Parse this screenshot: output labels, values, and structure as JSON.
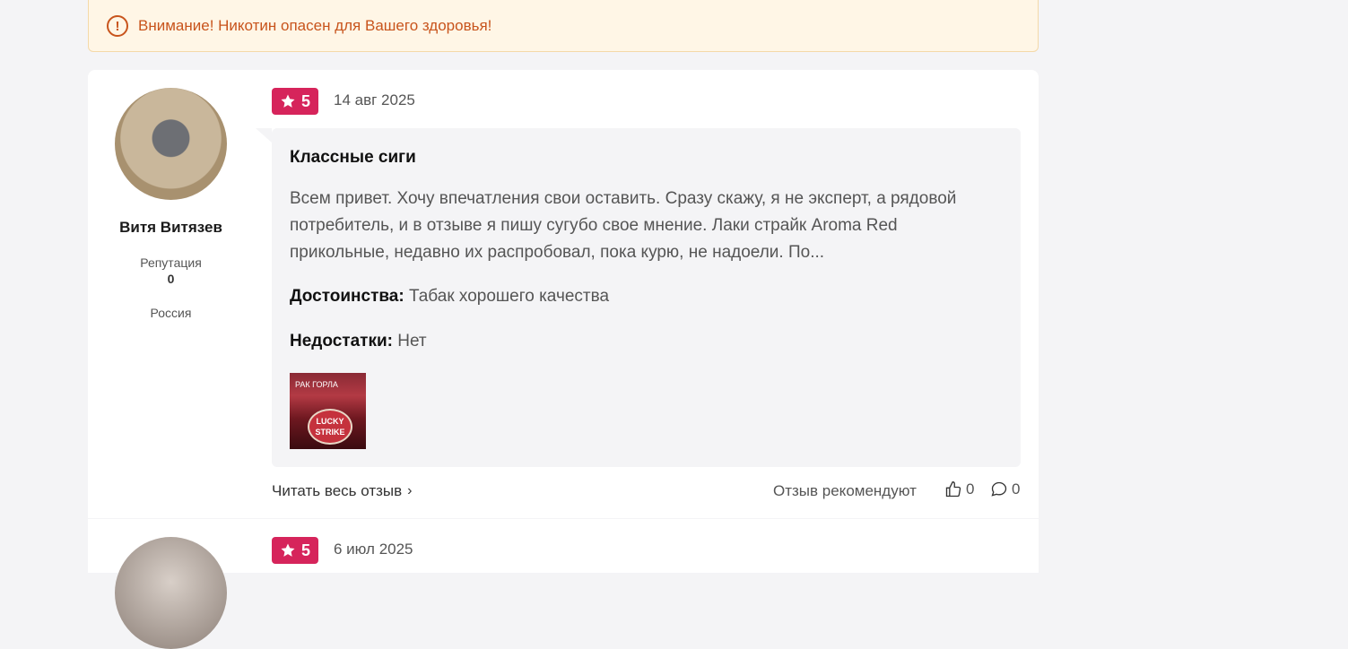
{
  "warning": {
    "icon": "exclamation-circle-icon",
    "text": "Внимание! Никотин опасен для Вашего здоровья!"
  },
  "review": {
    "author": {
      "name": "Витя Витязев",
      "reputation_label": "Репутация",
      "reputation_value": "0",
      "country": "Россия"
    },
    "rating": "5",
    "date": "14 авг 2025",
    "title": "Классные сиги",
    "body": "Всем привет. Хочу впечатления свои оставить. Сразу скажу, я не эксперт, а рядовой потребитель, и в отзыве я пишу сугубо свое мнение. Лаки страйк Aroma Red прикольные, недавно их распробовал, пока курю, не надоели. По...",
    "pros_label": "Достоинства:",
    "pros_text": "Табак хорошего качества",
    "cons_label": "Недостатки:",
    "cons_text": "Нет",
    "photo": {
      "top_text": "РАК ГОРЛА",
      "brand_text": "LUCKY STRIKE"
    },
    "read_more": "Читать весь отзыв",
    "recommend_label": "Отзыв рекомендуют",
    "likes": "0",
    "comments": "0"
  },
  "review_2": {
    "rating": "5",
    "date": "6 июл 2025"
  },
  "colors": {
    "accent": "#d6245b",
    "warning": "#c8541c",
    "warning_bg": "#fff6e6"
  }
}
